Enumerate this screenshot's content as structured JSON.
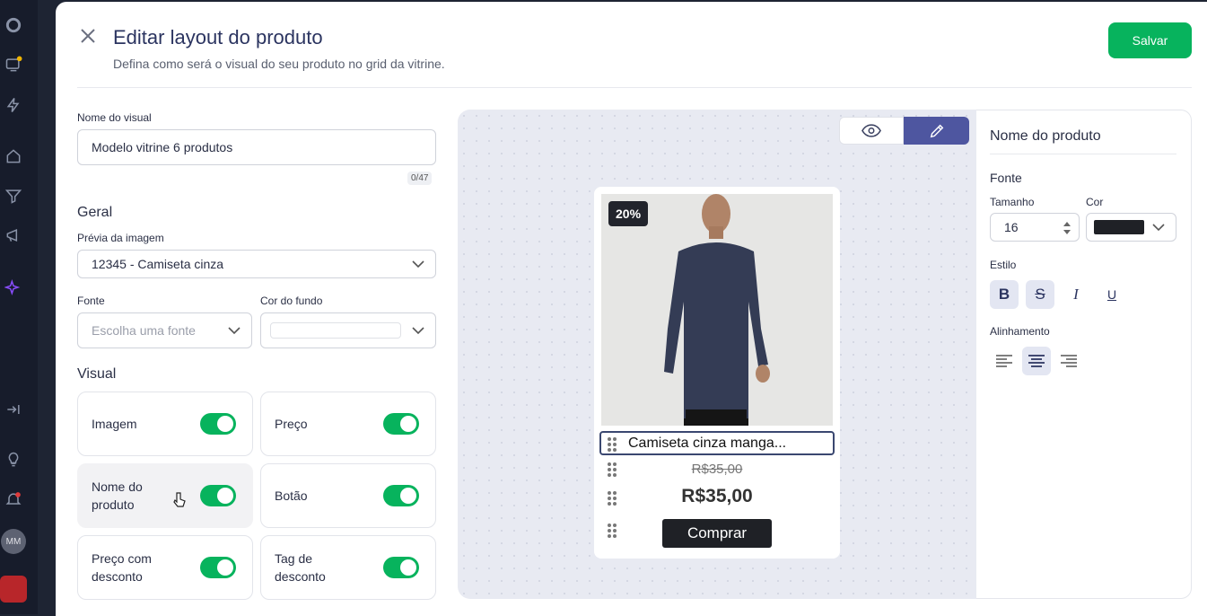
{
  "sidebar": {
    "items": [
      "logo-icon",
      "store-icon",
      "bolt-icon",
      "home-icon",
      "filter-icon",
      "megaphone-icon",
      "sparkles-icon",
      "collapse-icon",
      "lightbulb-icon",
      "bell-icon"
    ],
    "avatar_initials": "MM"
  },
  "header": {
    "title": "Editar layout do produto",
    "subtitle": "Defina como será o visual do seu produto no grid da vitrine.",
    "save_label": "Salvar"
  },
  "form": {
    "visual_name_label": "Nome do visual",
    "visual_name_value": "Modelo vitrine 6 produtos",
    "counter": "0/47",
    "general_heading": "Geral",
    "preview_label": "Prévia da imagem",
    "preview_value": "12345 - Camiseta cinza",
    "font_label": "Fonte",
    "font_placeholder": "Escolha uma fonte",
    "bg_label": "Cor do fundo",
    "visual_heading": "Visual",
    "toggles": [
      {
        "label": "Imagem",
        "on": true
      },
      {
        "label": "Preço",
        "on": true
      },
      {
        "label": "Nome do produto",
        "on": true
      },
      {
        "label": "Botão",
        "on": true
      },
      {
        "label": "Preço com desconto",
        "on": true
      },
      {
        "label": "Tag de desconto",
        "on": true
      }
    ]
  },
  "preview": {
    "badge": "20%",
    "product_name": "Camiseta cinza manga...",
    "old_price": "R$35,00",
    "price": "R$35,00",
    "buy_label": "Comprar"
  },
  "properties": {
    "title": "Nome do produto",
    "font_heading": "Fonte",
    "size_label": "Tamanho",
    "size_value": "16",
    "color_label": "Cor",
    "color_value": "#1f2126",
    "style_label": "Estilo",
    "alignment_label": "Alinhamento"
  },
  "colors": {
    "accent": "#07b35d",
    "primary": "#4e56a0",
    "text": "#2b3460"
  }
}
